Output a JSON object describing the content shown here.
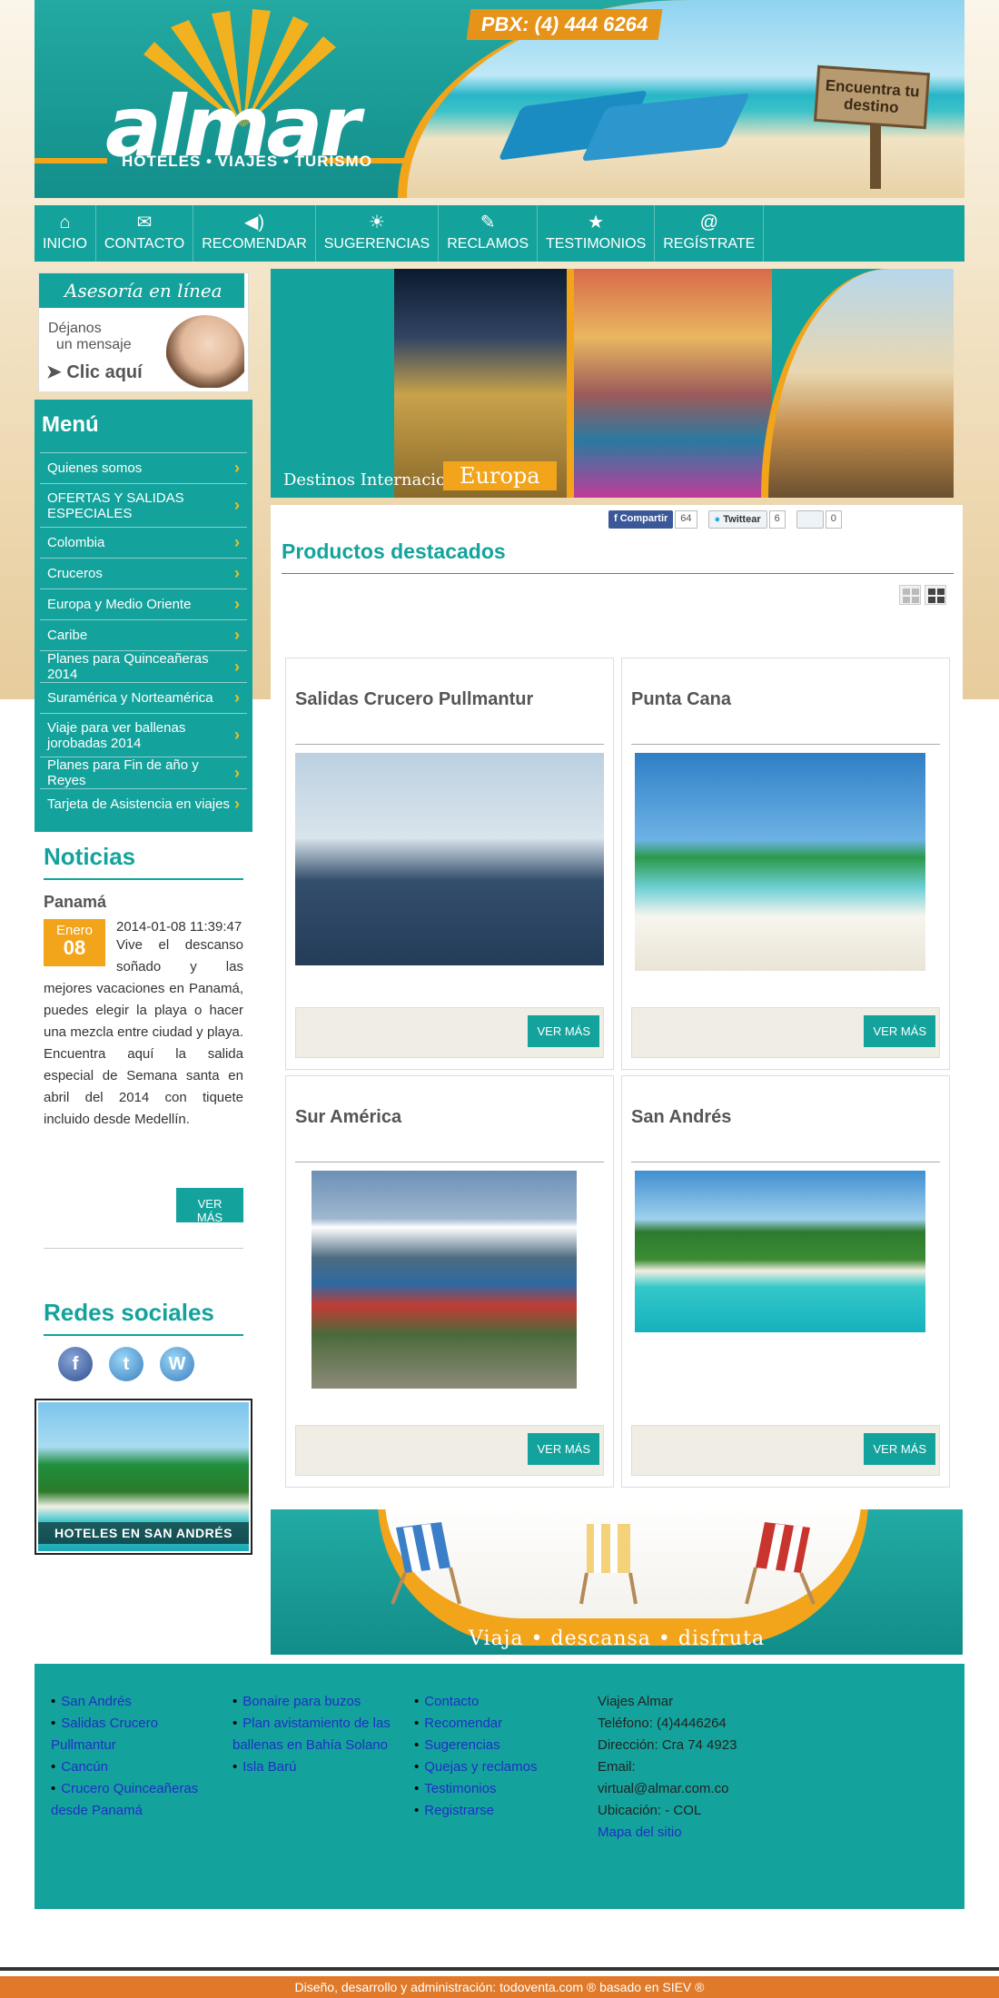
{
  "header": {
    "brand": "almar",
    "tagline": "HOTELES • VIAJES • TURISMO",
    "pbx": "PBX: (4) 444 6264",
    "sign": "Encuentra tu destino"
  },
  "nav": [
    {
      "icon": "⌂",
      "label": "INICIO"
    },
    {
      "icon": "✉",
      "label": "CONTACTO"
    },
    {
      "icon": "◀)",
      "label": "RECOMENDAR"
    },
    {
      "icon": "☀",
      "label": "SUGERENCIAS"
    },
    {
      "icon": "✎",
      "label": "RECLAMOS"
    },
    {
      "icon": "★",
      "label": "TESTIMONIOS"
    },
    {
      "icon": "@",
      "label": "REGÍSTRATE"
    }
  ],
  "asesoria": {
    "title": "Asesoría en línea",
    "line1": "Déjanos",
    "line2": "un mensaje",
    "cta": "Clic aquí"
  },
  "menu": {
    "title": "Menú",
    "items": [
      "Quienes somos",
      "OFERTAS Y SALIDAS ESPECIALES",
      "Colombia",
      "Cruceros",
      "Europa y Medio Oriente",
      "Caribe",
      "Planes para Quinceañeras 2014",
      "Suramérica y Norteamérica",
      "Viaje para ver ballenas jorobadas 2014",
      "Planes para Fin de año y Reyes",
      "Tarjeta de Asistencia en viajes"
    ]
  },
  "noticias": {
    "title": "Noticias",
    "headline": "Panamá",
    "month": "Enero",
    "day": "08",
    "timestamp": "2014-01-08 11:39:47",
    "body": "Vive el descanso soñado y las mejores vacaciones en Panamá, puedes elegir la playa o hacer una mezcla entre ciudad y playa. Encuentra aquí la salida especial de Semana santa en abril del 2014 con tiquete incluido desde Medellín.",
    "more": "VER MÁS"
  },
  "redes": {
    "title": "Redes sociales",
    "icons": [
      "facebook-icon",
      "twitter-icon",
      "wordpress-icon"
    ]
  },
  "hotel_banner": "HOTELES EN SAN ANDRÉS",
  "hero": {
    "subtitle": "Destinos Internacionales",
    "title": "Europa"
  },
  "share": {
    "fb_label": "Compartir",
    "fb_count": "64",
    "tw_label": "Twittear",
    "tw_count": "6",
    "g_count": "0"
  },
  "products": {
    "title": "Productos destacados",
    "items": [
      {
        "name": "Salidas Crucero Pullmantur",
        "button": "VER MÁS"
      },
      {
        "name": "Punta Cana",
        "button": "VER MÁS"
      },
      {
        "name": "Sur América",
        "button": "VER MÁS"
      },
      {
        "name": "San Andrés",
        "button": "VER MÁS"
      }
    ]
  },
  "promo": {
    "tagline": "Viaja • descansa • disfruta"
  },
  "footer": {
    "col1": [
      "San Andrés",
      "Salidas Crucero Pullmantur",
      "Cancún",
      "Crucero Quinceañeras desde Panamá"
    ],
    "col2": [
      "Bonaire para buzos",
      "Plan avistamiento de las ballenas en Bahía Solano",
      "Isla Barú"
    ],
    "col3": [
      "Contacto",
      "Recomendar",
      "Sugerencias",
      "Quejas y reclamos",
      "Testimonios",
      "Registrarse"
    ],
    "contact": {
      "company": "Viajes Almar",
      "phone": "Teléfono: (4)4446264",
      "address": "Dirección: Cra 74 4923",
      "email_label": "Email:",
      "email": "virtual@almar.com.co",
      "location": "Ubicación: - COL",
      "sitemap": "Mapa del sitio"
    },
    "credits": "Diseño, desarrollo y administración: todoventa.com ® basado en SIEV ®"
  }
}
